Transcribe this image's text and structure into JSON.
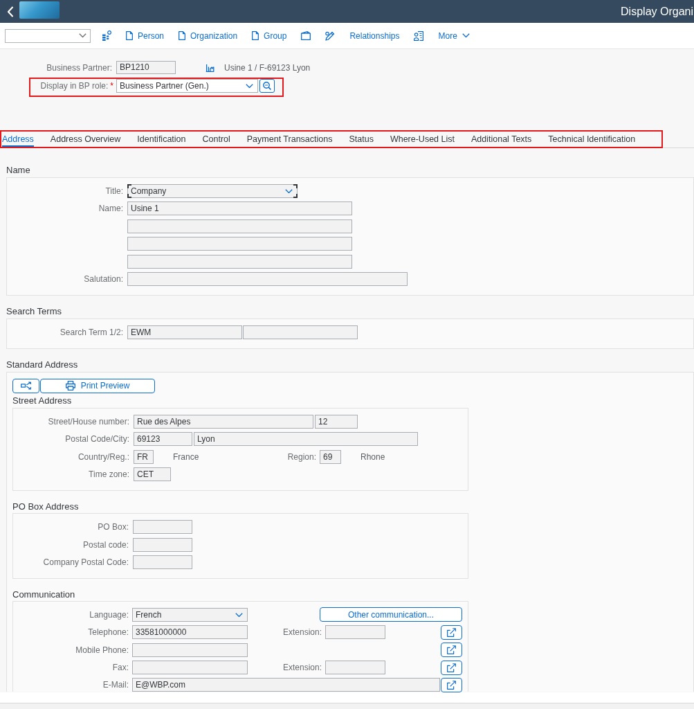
{
  "header": {
    "title": "Display Organi"
  },
  "toolbar": {
    "buttons": [
      {
        "label": "Person",
        "kind": "icon_label"
      },
      {
        "label": "Organization",
        "kind": "icon_label"
      },
      {
        "label": "Group",
        "kind": "icon_label"
      },
      {
        "label": "Relationships",
        "kind": "label"
      }
    ],
    "more": "More"
  },
  "partner": {
    "label": "Business Partner:",
    "value": "BP1210",
    "description": "Usine 1 / F-69123 Lyon"
  },
  "role": {
    "label": "Display in BP role:",
    "required_mark": "*",
    "value": "Business Partner (Gen.)",
    "highlighted": true
  },
  "tab_bar": {
    "highlighted": true,
    "tabs": [
      {
        "label": "Address",
        "selected": true
      },
      {
        "label": "Address Overview",
        "selected": false
      },
      {
        "label": "Identification",
        "selected": false
      },
      {
        "label": "Control",
        "selected": false
      },
      {
        "label": "Payment Transactions",
        "selected": false
      },
      {
        "label": "Status",
        "selected": false
      },
      {
        "label": "Where-Used List",
        "selected": false
      },
      {
        "label": "Additional Texts",
        "selected": false
      },
      {
        "label": "Technical Identification",
        "selected": false
      }
    ]
  },
  "sections": [
    {
      "heading": "Name",
      "rows": [
        {
          "label": "Title:",
          "items": [
            {
              "kind": "select",
              "value": "Company",
              "focused": true
            }
          ]
        },
        {
          "label": "Name:",
          "items": [
            {
              "kind": "input",
              "value": "Usine 1",
              "focused": false
            }
          ]
        },
        {
          "items": [
            {
              "kind": "input",
              "focused": false
            }
          ]
        },
        {
          "items": [
            {
              "kind": "input",
              "focused": false
            }
          ]
        },
        {
          "items": [
            {
              "kind": "input",
              "focused": false
            }
          ]
        },
        {
          "label": "Salutation:",
          "items": [
            {
              "kind": "input",
              "focused": false
            }
          ]
        }
      ]
    },
    {
      "heading": "Search Terms",
      "rows": [
        {
          "label": "Search Term 1/2:",
          "items": [
            {
              "kind": "input",
              "value": "EWM",
              "focused": false
            },
            {
              "kind": "input",
              "focused": false
            }
          ]
        }
      ]
    },
    {
      "heading": "Standard Address",
      "print_button": "Print Preview",
      "subsections": [
        {
          "heading": "Street Address",
          "rows": [
            {
              "label": "Street/House number:",
              "items": [
                {
                  "kind": "input",
                  "value": "Rue des Alpes",
                  "focused": false
                },
                {
                  "kind": "input",
                  "value": "12",
                  "focused": false
                }
              ]
            },
            {
              "label": "Postal Code/City:",
              "items": [
                {
                  "kind": "input",
                  "value": "69123",
                  "focused": false
                },
                {
                  "kind": "input",
                  "value": "Lyon",
                  "focused": false
                }
              ]
            },
            {
              "label": "Country/Reg.:",
              "items": [
                {
                  "kind": "input",
                  "value": "FR",
                  "focused": false
                },
                {
                  "kind": "text",
                  "value": "France"
                },
                {
                  "kind": "label",
                  "value": "Region:"
                },
                {
                  "kind": "input",
                  "value": "69",
                  "focused": false
                },
                {
                  "kind": "text",
                  "value": "Rhone"
                }
              ]
            },
            {
              "label": "Time zone:",
              "items": [
                {
                  "kind": "input",
                  "value": "CET",
                  "focused": false
                }
              ]
            }
          ]
        },
        {
          "heading": "PO Box Address",
          "rows": [
            {
              "label": "PO Box:",
              "items": [
                {
                  "kind": "input",
                  "focused": false
                }
              ]
            },
            {
              "label": "Postal code:",
              "items": [
                {
                  "kind": "input",
                  "focused": false
                }
              ]
            },
            {
              "label": "Company Postal Code:",
              "items": [
                {
                  "kind": "input",
                  "focused": false
                }
              ]
            }
          ]
        },
        {
          "heading": "Communication",
          "rows": [
            {
              "label": "Language:",
              "items": [
                {
                  "kind": "select",
                  "value": "French",
                  "focused": false
                },
                {
                  "kind": "button",
                  "value": "Other communication..."
                }
              ]
            },
            {
              "label": "Telephone:",
              "items": [
                {
                  "kind": "input",
                  "value": "33581000000",
                  "focused": false
                },
                {
                  "kind": "label",
                  "value": "Extension:"
                },
                {
                  "kind": "input",
                  "focused": false
                },
                {
                  "kind": "icon_button"
                }
              ]
            },
            {
              "label": "Mobile Phone:",
              "items": [
                {
                  "kind": "input",
                  "focused": false
                },
                {
                  "kind": "icon_button"
                }
              ]
            },
            {
              "label": "Fax:",
              "items": [
                {
                  "kind": "input",
                  "focused": false
                },
                {
                  "kind": "label",
                  "value": "Extension:"
                },
                {
                  "kind": "input",
                  "focused": false
                },
                {
                  "kind": "icon_button"
                }
              ]
            },
            {
              "label": "E-Mail:",
              "items": [
                {
                  "kind": "input",
                  "value": "E@WBP.com",
                  "focused": false
                },
                {
                  "kind": "icon_button"
                }
              ]
            }
          ]
        }
      ]
    }
  ]
}
